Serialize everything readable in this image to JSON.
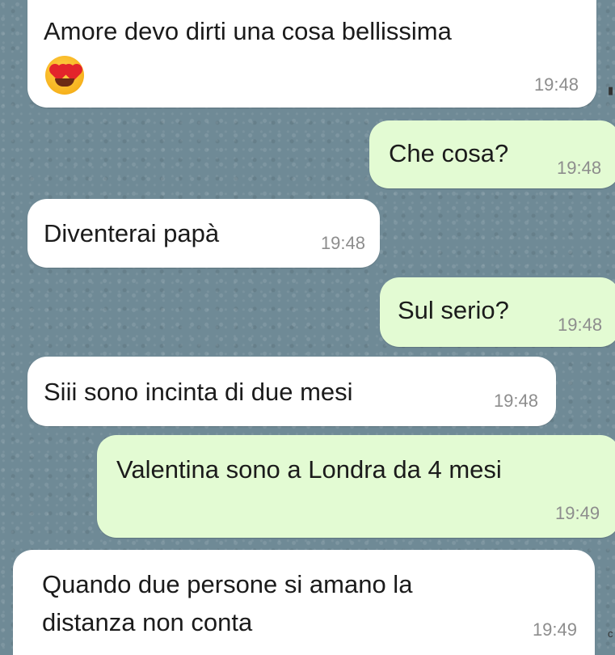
{
  "messages": [
    {
      "id": 1,
      "sender": "incoming",
      "text": "Amore devo dirti una cosa bellissima",
      "emoji": "heart-eyes-emoji",
      "time": "19:48"
    },
    {
      "id": 2,
      "sender": "outgoing",
      "text": "Che cosa?",
      "time": "19:48"
    },
    {
      "id": 3,
      "sender": "incoming",
      "text": "Diventerai papà",
      "time": "19:48"
    },
    {
      "id": 4,
      "sender": "outgoing",
      "text": "Sul serio?",
      "time": "19:48"
    },
    {
      "id": 5,
      "sender": "incoming",
      "text": "Siii sono incinta di due mesi",
      "time": "19:48"
    },
    {
      "id": 6,
      "sender": "outgoing",
      "text": "Valentina sono a Londra da 4 mesi",
      "time": "19:49"
    },
    {
      "id": 7,
      "sender": "incoming",
      "lines": [
        "Quando due persone si amano la",
        "distanza non conta"
      ],
      "time": "19:49"
    }
  ],
  "colors": {
    "incoming_bubble": "#ffffff",
    "outgoing_bubble": "#e3fbd3",
    "wallpaper": "#6f8a96",
    "timestamp": "#8d8d8d"
  }
}
